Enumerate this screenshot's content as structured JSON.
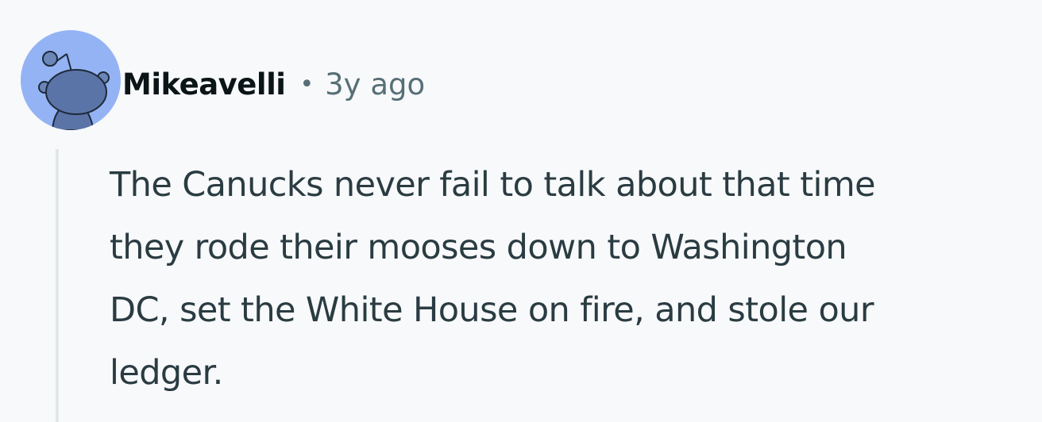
{
  "comment": {
    "author": "Mikeavelli",
    "separator": "•",
    "timestamp": "3y ago",
    "avatar_icon": "snoo-avatar-icon",
    "avatar_color": "#94b3f4",
    "body_lines": [
      "The Canucks never fail to talk about that time",
      "they rode their mooses down to Washington",
      "DC, set the White House on fire, and stole our",
      "ledger."
    ]
  }
}
